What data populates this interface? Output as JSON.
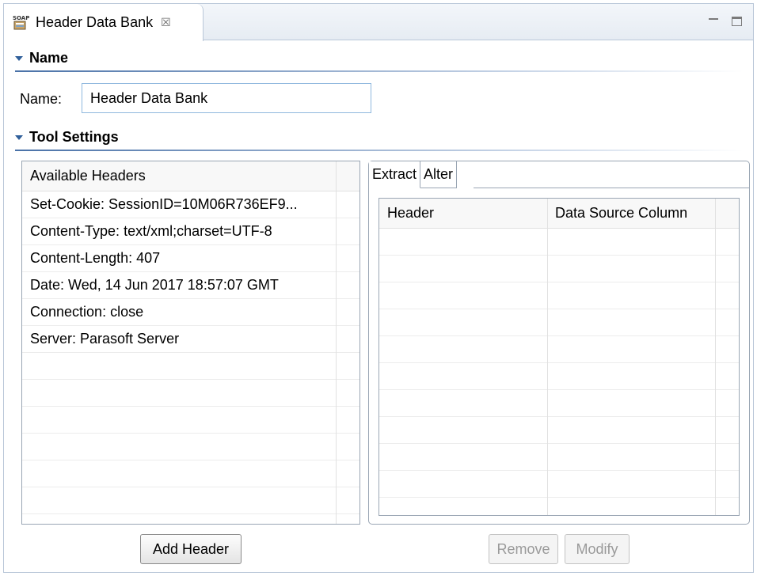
{
  "tab": {
    "title": "Header Data Bank",
    "close": "☒"
  },
  "name_section": {
    "heading": "Name",
    "label": "Name:",
    "value": "Header Data Bank"
  },
  "tool_section": {
    "heading": "Tool Settings"
  },
  "available_headers": {
    "column": "Available Headers",
    "rows": [
      "Set-Cookie: SessionID=10M06R736EF9...",
      "Content-Type: text/xml;charset=UTF-8",
      "Content-Length: 407",
      "Date: Wed, 14 Jun 2017 18:57:07 GMT",
      "Connection: close",
      "Server: Parasoft Server"
    ]
  },
  "right_tabs": [
    "Extract",
    "Alter"
  ],
  "extract_table": {
    "columns": [
      "Header",
      "Data Source Column"
    ]
  },
  "buttons": {
    "add_header": "Add Header",
    "remove": "Remove",
    "modify": "Modify"
  },
  "colors": {
    "accent": "#2f5f9a",
    "border": "#9aa6b4"
  }
}
